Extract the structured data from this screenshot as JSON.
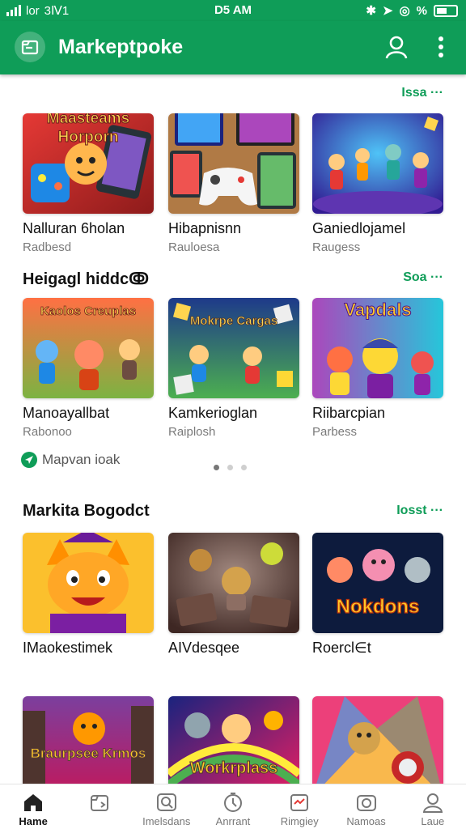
{
  "status_bar": {
    "carrier": "lоr",
    "left_time": "3Ⅳ1",
    "time": "D5 AM",
    "battery_label": "%"
  },
  "app_bar": {
    "title": "Markeptpoke"
  },
  "sections": [
    {
      "title": "",
      "more": "Issa ···",
      "cards": [
        {
          "title": "Nalluran 6holan",
          "sub": "Radbesd",
          "art": "Maasteams Horporn"
        },
        {
          "title": "Hibapnisnn",
          "sub": "Rauloesa",
          "art": ""
        },
        {
          "title": "Ganiedlojamel",
          "sub": "Raugess",
          "art": ""
        }
      ]
    },
    {
      "title": "Heigagl hiddcↂ",
      "more": "Soa ···",
      "cards": [
        {
          "title": "Manoayallbat",
          "sub": "Rabonoo",
          "art": "Kaolos Creuplas"
        },
        {
          "title": "Kamkerioglan",
          "sub": "Raiplosh",
          "art": "Mokrpe Cargas"
        },
        {
          "title": "Riibarcpian",
          "sub": "Parbess",
          "art": "Vapdals"
        }
      ]
    },
    {
      "title": "Markita Bogodct",
      "more": "Iosst ···",
      "cards": [
        {
          "title": "IMaokestimek",
          "sub": "",
          "art": ""
        },
        {
          "title": "AIVdesqee",
          "sub": "",
          "art": ""
        },
        {
          "title": "Roercl∈t",
          "sub": "",
          "art": "Nokdons"
        }
      ]
    },
    {
      "title": "",
      "more": "",
      "cards": [
        {
          "title": "",
          "sub": "",
          "art": "Braurpsee Krmos"
        },
        {
          "title": "",
          "sub": "",
          "art": "Workrplass"
        },
        {
          "title": "",
          "sub": "",
          "art": ""
        }
      ]
    }
  ],
  "map_link": {
    "label": "Mapvan ioak"
  },
  "pager": {
    "count": 3,
    "active": 0
  },
  "bottom_nav": [
    {
      "label": "Hame",
      "icon": "home-icon",
      "active": true
    },
    {
      "label": "",
      "icon": "store-icon",
      "active": false
    },
    {
      "label": "Imelsdans",
      "icon": "search-icon",
      "active": false
    },
    {
      "label": "Anrrant",
      "icon": "clock-icon",
      "active": false
    },
    {
      "label": "Rimgiey",
      "icon": "chart-icon",
      "active": false
    },
    {
      "label": "Namoas",
      "icon": "camera-icon",
      "active": false
    },
    {
      "label": "Laue",
      "icon": "user-icon",
      "active": false
    }
  ],
  "colors": {
    "primary": "#0f9d58",
    "text": "#111111",
    "subtle": "#7a7a7a"
  }
}
